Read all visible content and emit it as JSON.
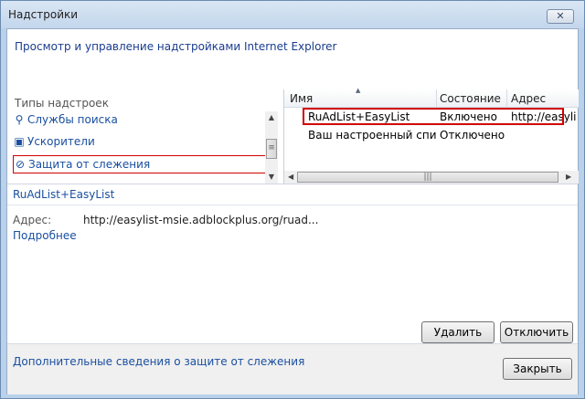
{
  "window": {
    "title": "Надстройки",
    "close_label": "✕"
  },
  "header": {
    "text": "Просмотр и управление надстройками Internet Explorer"
  },
  "left_panel": {
    "types_label": "Типы надстроек",
    "items": [
      {
        "label": "Службы поиска",
        "icon": "search-icon",
        "glyph": "⚲"
      },
      {
        "label": "Ускорители",
        "icon": "accelerator-icon",
        "glyph": "▣"
      },
      {
        "label": "Защита от слежения",
        "icon": "tracking-protection-icon",
        "glyph": "⊘",
        "selected": true
      }
    ]
  },
  "grid": {
    "columns": [
      "Имя",
      "Состояние",
      "Адрес"
    ],
    "rows": [
      {
        "name": "RuAdList+EasyList",
        "status": "Включено",
        "address": "http://easylist-msie",
        "selected": true
      },
      {
        "name": "Ваш настроенный спис...",
        "status": "Отключено",
        "address": ""
      }
    ]
  },
  "details": {
    "title": "RuAdList+EasyList",
    "address_label": "Адрес:",
    "address_value": "http://easylist-msie.adblockplus.org/ruad...",
    "more_link": "Подробнее"
  },
  "buttons": {
    "delete": "Удалить",
    "disable": "Отключить",
    "close": "Закрыть"
  },
  "footer": {
    "link": "Дополнительные сведения о защите от слежения"
  },
  "colors": {
    "link": "#1a4fa0",
    "selection_outline": "#d10000"
  }
}
